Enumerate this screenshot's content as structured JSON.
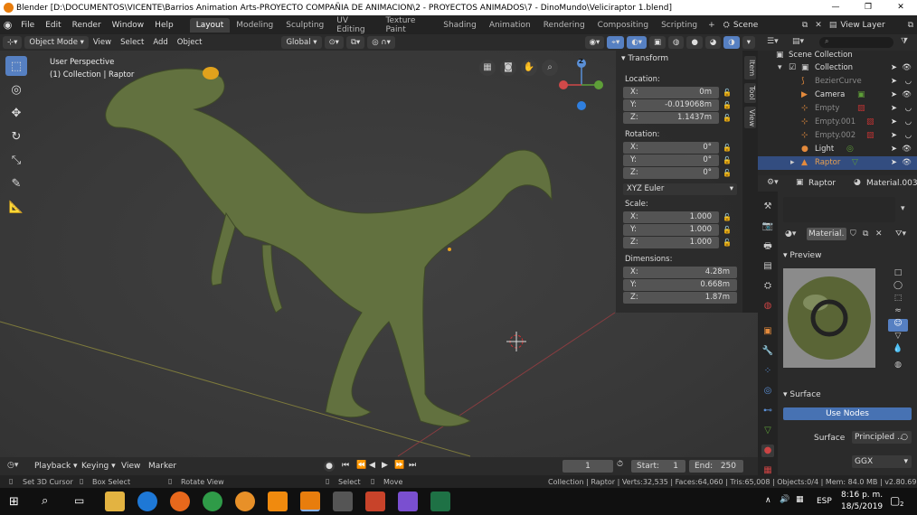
{
  "window": {
    "title": "Blender [D:\\DOCUMENTOS\\VICENTE\\Barrios Animation Arts-PROYECTO COMPAÑIA DE ANIMACION\\2 - PROYECTOS ANIMADOS\\7 - DinoMundo\\Veliciraptor 1.blend]"
  },
  "menus": [
    "File",
    "Edit",
    "Render",
    "Window",
    "Help"
  ],
  "workspaces": [
    "Layout",
    "Modeling",
    "Sculpting",
    "UV Editing",
    "Texture Paint",
    "Shading",
    "Animation",
    "Rendering",
    "Compositing",
    "Scripting"
  ],
  "scene": "Scene",
  "view_layer": "View Layer",
  "header3d": {
    "mode": "Object Mode",
    "view": "View",
    "select": "Select",
    "add": "Add",
    "object": "Object",
    "orientation": "Global"
  },
  "viewport": {
    "perspective": "User Perspective",
    "collection": "(1) Collection | Raptor"
  },
  "gizmo": {
    "z": "Z"
  },
  "npanel": {
    "title": "Transform",
    "location_label": "Location:",
    "location": [
      {
        "k": "X:",
        "v": "0m"
      },
      {
        "k": "Y:",
        "v": "-0.019068m"
      },
      {
        "k": "Z:",
        "v": "1.1437m"
      }
    ],
    "rotation_label": "Rotation:",
    "rotation": [
      {
        "k": "X:",
        "v": "0°"
      },
      {
        "k": "Y:",
        "v": "0°"
      },
      {
        "k": "Z:",
        "v": "0°"
      }
    ],
    "euler": "XYZ Euler",
    "scale_label": "Scale:",
    "scale": [
      {
        "k": "X:",
        "v": "1.000"
      },
      {
        "k": "Y:",
        "v": "1.000"
      },
      {
        "k": "Z:",
        "v": "1.000"
      }
    ],
    "dimensions_label": "Dimensions:",
    "dimensions": [
      {
        "k": "X:",
        "v": "4.28m"
      },
      {
        "k": "Y:",
        "v": "0.668m"
      },
      {
        "k": "Z:",
        "v": "1.87m"
      }
    ]
  },
  "sidetabs": [
    "Item",
    "Tool",
    "View"
  ],
  "outliner": {
    "rows": [
      "Scene Collection",
      "Collection",
      "BezierCurve",
      "Camera",
      "Empty",
      "Empty.001",
      "Empty.002",
      "Light",
      "Raptor"
    ],
    "selected": "Raptor"
  },
  "properties": {
    "object": "Raptor",
    "material": "Material.003",
    "material_slot": "Material.",
    "preview_label": "Preview",
    "surface_header": "Surface",
    "use_nodes": "Use Nodes",
    "surface_label": "Surface",
    "surface_value": "Principled ..",
    "distribution": "GGX"
  },
  "timeline": {
    "playback": "Playback",
    "keying": "Keying",
    "view": "View",
    "marker": "Marker",
    "current": "1",
    "start_label": "Start:",
    "start": "1",
    "end_label": "End:",
    "end": "250"
  },
  "status": {
    "cursor": "Set 3D Cursor",
    "box": "Box Select",
    "rotate": "Rotate View",
    "select": "Select",
    "move": "Move",
    "info": "Collection | Raptor | Verts:32,535 | Faces:64,060 | Tris:65,008 | Objects:0/4 | Mem: 84.0 MB | v2.80.69"
  },
  "taskbar": {
    "lang": "ESP",
    "time": "8:16 p. m.",
    "date": "18/5/2019",
    "notif": "2"
  },
  "colors": {
    "accent": "#5680c2",
    "selected_row": "#334d80",
    "raptor": "#62713f",
    "use_nodes": "#4772b3"
  }
}
